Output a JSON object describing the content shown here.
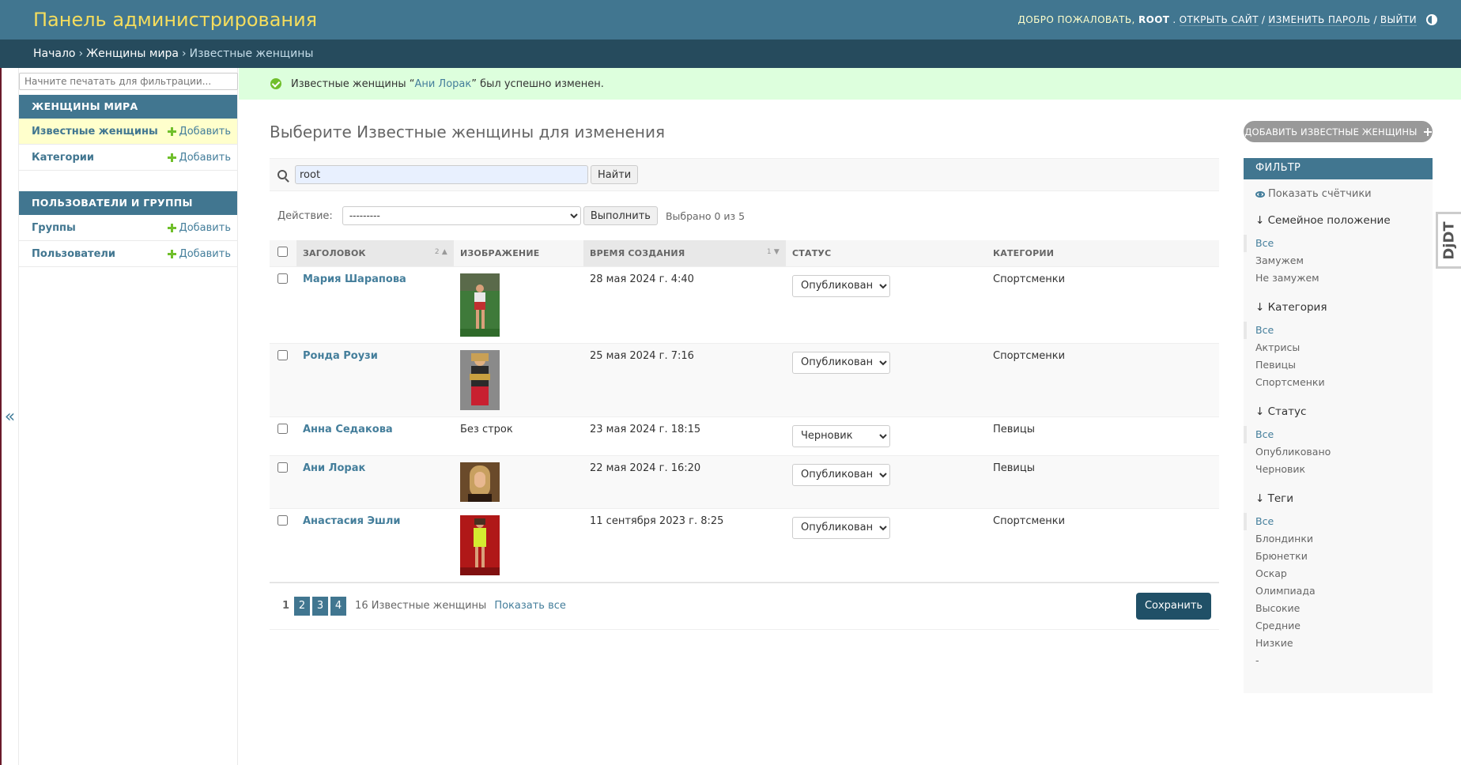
{
  "header": {
    "site_name": "Панель администрирования",
    "welcome": "Добро пожаловать,",
    "username": "root",
    "view_site": "Открыть сайт",
    "change_password": "Изменить пароль",
    "logout": "Выйти",
    "sep": "/"
  },
  "breadcrumbs": [
    {
      "label": "Начало"
    },
    {
      "label": "Женщины мира"
    },
    {
      "label": "Известные женщины"
    }
  ],
  "breadcrumb_sep": "›",
  "sidebar": {
    "toggle": "«",
    "filter_placeholder": "Начните печатать для фильтрации...",
    "modules": [
      {
        "caption": "Женщины мира",
        "items": [
          {
            "label": "Известные женщины",
            "add": "Добавить",
            "current": true
          },
          {
            "label": "Категории",
            "add": "Добавить"
          }
        ]
      },
      {
        "caption": "Пользователи и группы",
        "items": [
          {
            "label": "Группы",
            "add": "Добавить"
          },
          {
            "label": "Пользователи",
            "add": "Добавить"
          }
        ]
      }
    ]
  },
  "message": {
    "prefix": "Известные женщины “",
    "link": "Ани Лорак",
    "suffix": "” был успешно изменен."
  },
  "page": {
    "title": "Выберите Известные женщины для изменения",
    "add_button": "Добавить Известные женщины"
  },
  "search": {
    "value": "root",
    "button": "Найти"
  },
  "actions": {
    "label": "Действие:",
    "selected_option": "---------",
    "go_button": "Выполнить",
    "counter": "Выбрано 0 из 5"
  },
  "table": {
    "columns": [
      {
        "label": "Заголовок",
        "sort": "2"
      },
      {
        "label": "Изображение"
      },
      {
        "label": "Время создания",
        "sort": "1"
      },
      {
        "label": "Статус"
      },
      {
        "label": "Категории"
      }
    ],
    "status_options": [
      "Опубликовано",
      "Черновик"
    ],
    "rows": [
      {
        "title": "Мария Шарапова",
        "image": "photo",
        "created": "28 мая 2024 г. 4:40",
        "status": "Опубликовано",
        "category": "Спортсменки"
      },
      {
        "title": "Ронда Роузи",
        "image": "photo",
        "created": "25 мая 2024 г. 7:16",
        "status": "Опубликовано",
        "category": "Спортсменки"
      },
      {
        "title": "Анна Седакова",
        "image_text": "Без строк",
        "created": "23 мая 2024 г. 18:15",
        "status": "Черновик",
        "category": "Певицы"
      },
      {
        "title": "Ани Лорак",
        "image": "photo",
        "created": "22 мая 2024 г. 16:20",
        "status": "Опубликовано",
        "category": "Певицы"
      },
      {
        "title": "Анастасия Эшли",
        "image": "photo",
        "created": "11 сентября 2023 г. 8:25",
        "status": "Опубликовано",
        "category": "Спортсменки"
      }
    ]
  },
  "pagination": {
    "current": "1",
    "pages": [
      "2",
      "3",
      "4"
    ],
    "count": "16 Известные женщины",
    "show_all": "Показать все",
    "save": "Сохранить"
  },
  "filter": {
    "title": "Фильтр",
    "show_counts": "Показать счётчики",
    "groups": [
      {
        "title": "↓ Семейное положение",
        "options": [
          "Все",
          "Замужем",
          "Не замужем"
        ]
      },
      {
        "title": "↓ Категория",
        "options": [
          "Все",
          "Актрисы",
          "Певицы",
          "Спортсменки"
        ]
      },
      {
        "title": "↓ Статус",
        "options": [
          "Все",
          "Опубликовано",
          "Черновик"
        ]
      },
      {
        "title": "↓ Теги",
        "options": [
          "Все",
          "Блондинки",
          "Брюнетки",
          "Оскар",
          "Олимпиада",
          "Высокие",
          "Средние",
          "Низкие",
          "-"
        ]
      }
    ]
  },
  "djdt": {
    "label": "DjDT"
  },
  "colors": {
    "header_bg": "#417690",
    "breadcrumbs_bg": "#264b5d",
    "site_name": "#f5dd5d",
    "link": "#447e9b",
    "success_bg": "#ddffdd",
    "add_green": "#70bf2b",
    "save_button": "#205067"
  }
}
